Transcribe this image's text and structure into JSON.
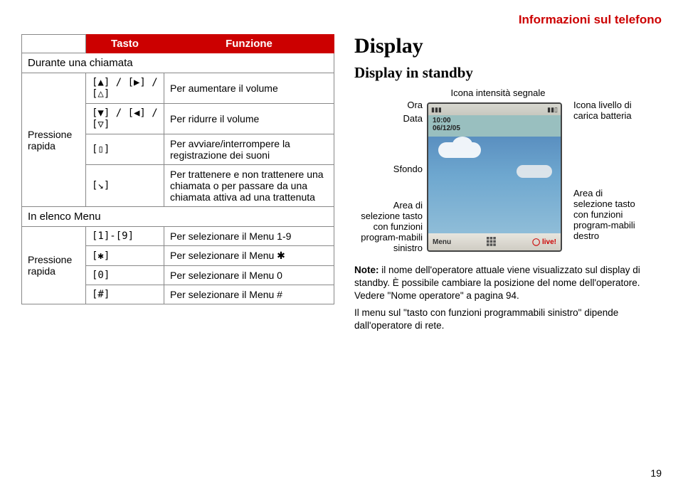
{
  "header_title": "Informazioni sul telefono",
  "table": {
    "col_tasto": "Tasto",
    "col_funzione": "Funzione",
    "section_call": "Durante una chiamata",
    "rows_call": [
      {
        "key": "[▲] / [▶] / [△]",
        "fn": "Per aumentare il volume"
      },
      {
        "key": "[▼] / [◀] / [▽]",
        "fn": "Per ridurre il volume"
      }
    ],
    "pressione_label": "Pressione rapida",
    "rows_press_call": [
      {
        "key": "[▯]",
        "fn": "Per avviare/interrompere la registrazione dei suoni"
      },
      {
        "key": "[↘]",
        "fn": "Per trattenere e non trattenere una chiamata o per passare da una chiamata attiva ad una trattenuta"
      }
    ],
    "section_menu": "In elenco Menu",
    "rows_menu_first": {
      "key": "[1]-[9]",
      "fn": "Per selezionare il Menu 1-9"
    },
    "rows_press_menu": [
      {
        "key": "[✱]",
        "fn": "Per selezionare il Menu ✱"
      },
      {
        "key": "[0]",
        "fn": "Per selezionare il Menu 0"
      },
      {
        "key": "[#]",
        "fn": "Per selezionare il Menu #"
      }
    ]
  },
  "right": {
    "display_title": "Display",
    "standby_title": "Display in standby",
    "labels": {
      "ora": "Ora",
      "data": "Data",
      "sfondo": "Sfondo",
      "area_left": "Area di selezione tasto con funzioni program-mabili sinistro",
      "signal": "Icona intensità segnale",
      "battery": "Icona livello di carica batteria",
      "area_right": "Area di selezione tasto con funzioni program-mabili destro"
    },
    "screen": {
      "time": "10:00",
      "date": "06/12/05",
      "softkey_left": "Menu",
      "softkey_right": "live!"
    },
    "note": {
      "lead": "Note:",
      "line1": " il nome dell'operatore attuale viene visualizzato sul display di standby. È possibile cambiare la posizione del nome dell'operatore. Vedere \"Nome operatore\" a pagina 94.",
      "line2": "Il menu sul \"tasto con funzioni programmabili sinistro\" dipende dall'operatore di rete."
    }
  },
  "page_num": "19"
}
